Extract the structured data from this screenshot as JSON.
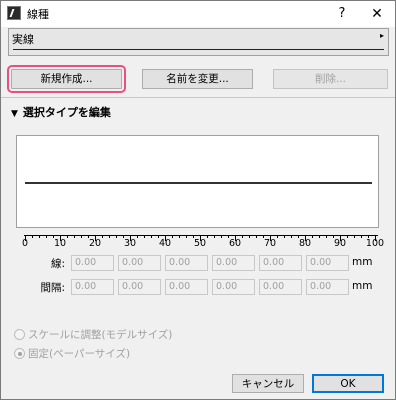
{
  "window": {
    "title": "線種",
    "help_glyph": "?",
    "close_glyph": "✕"
  },
  "type_selector": {
    "label": "実線",
    "arrow_glyph": "▸"
  },
  "buttons": {
    "new": "新規作成...",
    "rename": "名前を変更...",
    "delete": "削除..."
  },
  "section": {
    "arrow_glyph": "▼",
    "title": "選択タイプを編集"
  },
  "ruler": {
    "labels": [
      "0",
      "10",
      "20",
      "30",
      "40",
      "50",
      "60",
      "70",
      "80",
      "90",
      "100"
    ]
  },
  "rows": {
    "line": {
      "label": "線:",
      "values": [
        "0.00",
        "0.00",
        "0.00",
        "0.00",
        "0.00",
        "0.00"
      ],
      "unit": "mm"
    },
    "gap": {
      "label": "間隔:",
      "values": [
        "0.00",
        "0.00",
        "0.00",
        "0.00",
        "0.00",
        "0.00"
      ],
      "unit": "mm"
    }
  },
  "scale_options": {
    "model": "スケールに調整(モデルサイズ)",
    "fixed": "固定(ペーパーサイズ)",
    "selected": "fixed"
  },
  "footer": {
    "cancel": "キャンセル",
    "ok": "OK"
  },
  "colors": {
    "highlight_ring": "#e8507f",
    "ok_border": "#0078d7"
  }
}
